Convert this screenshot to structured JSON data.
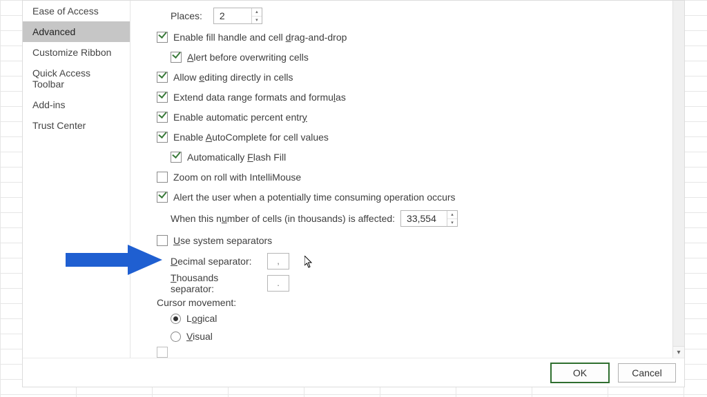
{
  "sidebar": {
    "items": [
      {
        "label": "Ease of Access"
      },
      {
        "label": "Advanced"
      },
      {
        "label": "Customize Ribbon"
      },
      {
        "label": "Quick Access Toolbar"
      },
      {
        "label": "Add-ins"
      },
      {
        "label": "Trust Center"
      }
    ],
    "selected_index": 1
  },
  "options": {
    "places_label": "Places:",
    "places_value": "2",
    "fill_handle": "Enable fill handle and cell drag-and-drop",
    "alert_overwrite": "Alert before overwriting cells",
    "allow_edit_in_cells": "Allow editing directly in cells",
    "extend_formats": "Extend data range formats and formulas",
    "auto_percent": "Enable automatic percent entry",
    "autocomplete": "Enable AutoComplete for cell values",
    "flash_fill": "Automatically Flash Fill",
    "zoom_intellimouse": "Zoom on roll with IntelliMouse",
    "alert_time_consuming": "Alert the user when a potentially time consuming operation occurs",
    "cells_affected_label": "When this number of cells (in thousands) is affected:",
    "cells_affected_value": "33,554",
    "use_system_separators": "Use system separators",
    "decimal_sep_label": "Decimal separator:",
    "decimal_sep_value": ",",
    "thousands_sep_label": "Thousands separator:",
    "thousands_sep_value": ".",
    "cursor_movement_label": "Cursor movement:",
    "cursor_logical": "Logical",
    "cursor_visual": "Visual"
  },
  "buttons": {
    "ok": "OK",
    "cancel": "Cancel"
  }
}
